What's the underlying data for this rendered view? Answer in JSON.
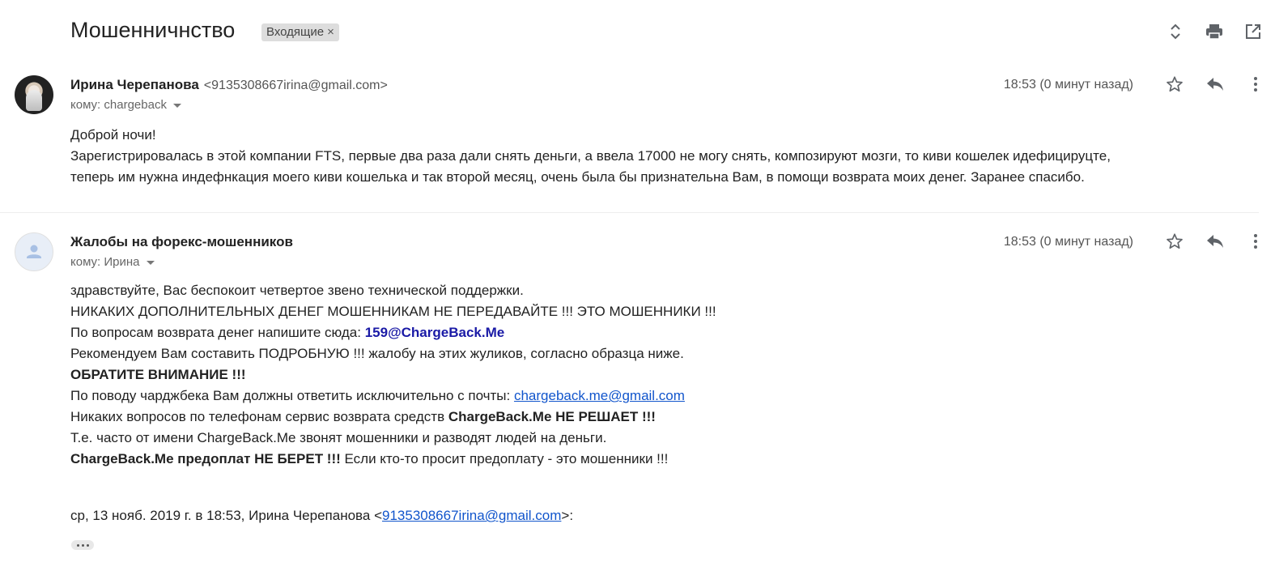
{
  "subject": "Мошенничнство",
  "label": "Входящие",
  "label_remove": "×",
  "messages": [
    {
      "sender_name": "Ирина Черепанова",
      "sender_email": "<9135308667irina@gmail.com>",
      "to": "кому: chargeback",
      "time": "18:53 (0 минут назад)",
      "body": [
        "Доброй ночи!",
        "Зарегистрировалась в этой компании FTS, первые два раза дали снять деньги, а ввела 17000 не могу снять, композируют мозги, то киви кошелек идефицируцте,",
        "теперь им нужна индефнкация моего киви кошелька и так второй месяц, очень была бы признательна Вам, в помощи  возврата моих денег. Заранее спасибо."
      ]
    },
    {
      "sender_name": "Жалобы на форекс-мошенников",
      "to": "кому: Ирина",
      "time": "18:53 (0 минут назад)",
      "line1": "здравствуйте, Вас беспокоит четвертое звено технической поддержки.",
      "line2": "НИКАКИХ ДОПОЛНИТЕЛЬНЫХ ДЕНЕГ МОШЕННИКАМ НЕ ПЕРЕДАВАЙТЕ !!! ЭТО МОШЕННИКИ !!!",
      "line3_text": "По вопросам возврата денег напишите сюда: ",
      "line3_email": "159@ChargeBack.Me",
      "line4": "Рекомендуем Вам составить ПОДРОБНУЮ !!! жалобу на этих жуликов, согласно образца ниже.",
      "line5": "ОБРАТИТЕ ВНИМАНИЕ !!!",
      "line6_text": "По поводу чарджбека Вам должны ответить исключительно с почты: ",
      "line6_link": "chargeback.me@gmail.com",
      "line7_text": "Никаких вопросов по телефонам сервис возврата средств ",
      "line7_bold": "ChargeBack.Me НЕ РЕШАЕТ !!!",
      "line8": "Т.е. часто от имени ChargeBack.Me звонят мошенники и разводят людей на деньги.",
      "line9_bold": "ChargeBack.Me предоплат НЕ БЕРЕТ !!!",
      "line9_text": " Если кто-то просит предоплату - это мошенники !!!",
      "quote_prefix": "ср, 13 нояб. 2019 г. в 18:53, Ирина Черепанова <",
      "quote_link": "9135308667irina@gmail.com",
      "quote_suffix": ">:"
    }
  ],
  "icons": {
    "expand": "unfold-icon",
    "print": "print-icon",
    "new_window": "open-in-new-icon",
    "star": "star-icon",
    "reply": "reply-icon",
    "more": "more-vert-icon"
  },
  "colors": {
    "link": "#1155cc",
    "label_bg": "#dddddd"
  }
}
